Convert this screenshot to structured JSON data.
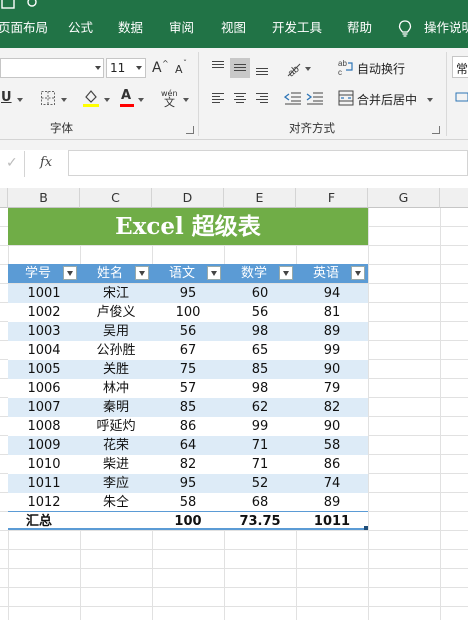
{
  "ribbon_tabs": [
    "页面布局",
    "公式",
    "数据",
    "审阅",
    "视图",
    "开发工具",
    "帮助",
    "操作说明"
  ],
  "font": {
    "name": "",
    "size": "11",
    "grow_label": "A",
    "shrink_label": "A",
    "group_label": "字体",
    "underline_label": "U",
    "color_label": "A",
    "phonetic_label": "wén"
  },
  "alignment": {
    "wrap_label": "自动换行",
    "merge_label": "合并后居中",
    "group_label": "对齐方式"
  },
  "number_format_partial": "常",
  "formula_bar": {
    "cancel_icon": "✓",
    "fx_label": "fx",
    "value": ""
  },
  "columns": [
    "B",
    "C",
    "D",
    "E",
    "F",
    "G"
  ],
  "sheet": {
    "title": "Excel 超级表",
    "headers": [
      "学号",
      "姓名",
      "语文",
      "数学",
      "英语"
    ],
    "rows": [
      [
        "1001",
        "宋江",
        "95",
        "60",
        "94"
      ],
      [
        "1002",
        "卢俊义",
        "100",
        "56",
        "81"
      ],
      [
        "1003",
        "吴用",
        "56",
        "98",
        "89"
      ],
      [
        "1004",
        "公孙胜",
        "67",
        "65",
        "99"
      ],
      [
        "1005",
        "关胜",
        "75",
        "85",
        "90"
      ],
      [
        "1006",
        "林冲",
        "57",
        "98",
        "79"
      ],
      [
        "1007",
        "秦明",
        "85",
        "62",
        "82"
      ],
      [
        "1008",
        "呼延灼",
        "86",
        "99",
        "90"
      ],
      [
        "1009",
        "花荣",
        "64",
        "71",
        "58"
      ],
      [
        "1010",
        "柴进",
        "82",
        "71",
        "86"
      ],
      [
        "1011",
        "李应",
        "95",
        "52",
        "74"
      ],
      [
        "1012",
        "朱仝",
        "58",
        "68",
        "89"
      ]
    ],
    "total": [
      "汇总",
      "",
      "100",
      "73.75",
      "1011"
    ]
  },
  "colors": {
    "ribbon_green": "#217346",
    "title_fill": "#70ad47",
    "header_fill": "#5b9bd5",
    "band_fill": "#ddebf7"
  }
}
